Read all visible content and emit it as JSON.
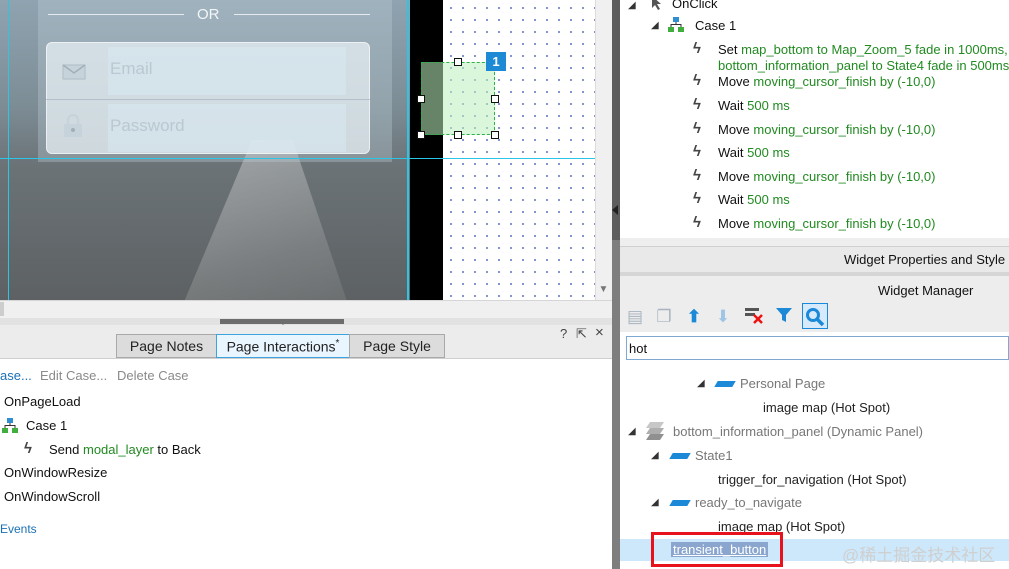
{
  "canvas": {
    "or_text": "OR",
    "email_placeholder": "Email",
    "password_placeholder": "Password",
    "badge_number": "1"
  },
  "bottom_panel": {
    "tabs": [
      {
        "label": "Page Notes"
      },
      {
        "label": "Page Interactions",
        "modified_marker": "*"
      },
      {
        "label": "Page Style"
      }
    ],
    "controls": {
      "help": "?",
      "pin": "⇱",
      "close": "×"
    },
    "actions": {
      "add_case": "ase...",
      "edit_case": "Edit Case...",
      "delete_case": "Delete Case"
    },
    "events": [
      {
        "name": "OnPageLoad"
      },
      {
        "name": "OnWindowResize"
      },
      {
        "name": "OnWindowScroll"
      }
    ],
    "case_label": "Case 1",
    "send_action": {
      "prefix": "Send ",
      "target": "modal_layer",
      "suffix": " to Back"
    },
    "more_events_link": "Events"
  },
  "right_top": {
    "event": "OnClick",
    "case_label": "Case 1",
    "rows": [
      {
        "verb": "Set ",
        "target": "map_bottom to Map_Zoom_5 fade in 1000ms,"
      },
      {
        "verb": "",
        "target": "bottom_information_panel to State4 fade in 500ms"
      },
      {
        "verb": "Move ",
        "target": "moving_cursor_finish by (-10,0)"
      },
      {
        "verb": "Wait ",
        "target": "500 ms"
      },
      {
        "verb": "Move ",
        "target": "moving_cursor_finish by (-10,0)"
      },
      {
        "verb": "Wait ",
        "target": "500 ms"
      },
      {
        "verb": "Move ",
        "target": "moving_cursor_finish by (-10,0)"
      },
      {
        "verb": "Wait ",
        "target": "500 ms"
      },
      {
        "verb": "Move ",
        "target": "moving_cursor_finish by (-10,0)"
      }
    ]
  },
  "widget_properties": {
    "title": "Widget Properties and Style"
  },
  "widget_manager": {
    "title": "Widget Manager",
    "filter_value": "hot",
    "tree": [
      {
        "label": "Personal Page"
      },
      {
        "label": "image map (Hot Spot)"
      },
      {
        "label": "bottom_information_panel (Dynamic Panel)"
      },
      {
        "label": "State1"
      },
      {
        "label": "trigger_for_navigation (Hot Spot)"
      },
      {
        "label": "ready_to_navigate"
      },
      {
        "label": "image map (Hot Spot)"
      },
      {
        "label": "transient_button"
      }
    ]
  },
  "watermark": "@稀土掘金技术社区",
  "colors": {
    "accent": "#29c6e8",
    "selection": "#cde8fb",
    "highlight_box": "#e8121c",
    "link": "#1a70b5",
    "green_text": "#218a21"
  }
}
